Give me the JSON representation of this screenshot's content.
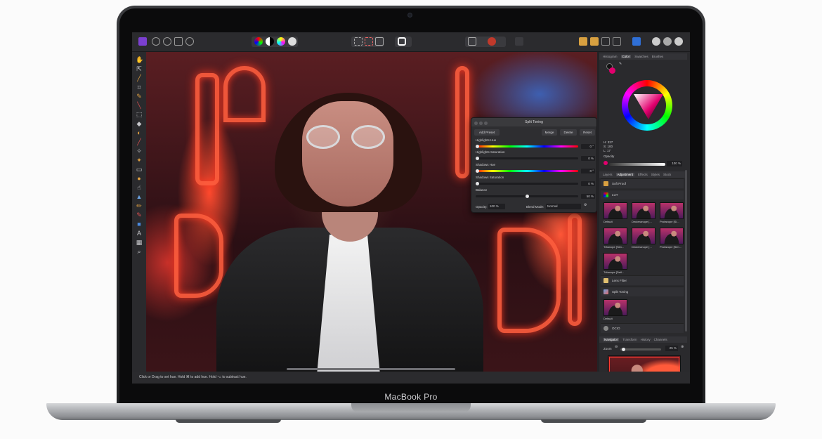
{
  "device": {
    "brand_label": "MacBook Pro"
  },
  "app": {
    "status_text": "Click or Drag to set hue. Hold ⌘ to add hue. Hold ⌥ to subtract hue.",
    "left_tools": [
      "hand-icon",
      "move-icon",
      "brush-icon",
      "crop-icon",
      "pen-icon",
      "eyedropper-icon",
      "marquee-icon",
      "fill-icon",
      "gradient-icon",
      "paint-icon",
      "retouch-icon",
      "clone-icon",
      "eraser-icon",
      "dodge-icon",
      "smudge-icon",
      "sharpen-icon",
      "shape-icon",
      "text-icon",
      "frame-icon",
      "zoom-icon"
    ]
  },
  "split_toning": {
    "title": "Split Toning",
    "add_preset": "Add Preset",
    "merge": "Merge",
    "delete": "Delete",
    "reset": "Reset",
    "highlights_hue_label": "Highlights Hue",
    "highlights_hue_value": "0 °",
    "highlights_sat_label": "Highlights Saturation",
    "highlights_sat_value": "0 %",
    "shadows_hue_label": "Shadows Hue",
    "shadows_hue_value": "0 °",
    "shadows_sat_label": "Shadows Saturation",
    "shadows_sat_value": "0 %",
    "balance_label": "Balance",
    "balance_value": "50 %",
    "opacity_label": "Opacity:",
    "opacity_value": "100 %",
    "blend_label": "Blend Mode:",
    "blend_value": "Normal"
  },
  "color_panel": {
    "tabs": [
      "Histogram",
      "Color",
      "Swatches",
      "Brushes"
    ],
    "active_tab": "Color",
    "h": "H: 337",
    "s": "S: 100",
    "l": "L: 17",
    "opacity_label": "Opacity",
    "opacity_value": "100 %",
    "primary_color": "#e2006e"
  },
  "adjustment_panel": {
    "tabs": [
      "Layers",
      "Adjustment",
      "Effects",
      "Styles",
      "Stock"
    ],
    "active_tab": "Adjustment",
    "items": {
      "soft_proof": "Soft Proof",
      "lut": "LUT",
      "lens_filter": "Lens Filter",
      "split_toning": "Split Toning",
      "ocio": "OCIO"
    },
    "lut_presets": [
      "Default",
      "Deuteranope [...",
      "Protanope [Si...",
      "Tritanope [Sim...",
      "Deuteranope [...",
      "Protanope [Sim...",
      "Tritanope [Defi..."
    ],
    "split_presets": [
      "Default"
    ]
  },
  "navigator_panel": {
    "tabs": [
      "Navigator",
      "Transform",
      "History",
      "Channels"
    ],
    "active_tab": "Navigator",
    "zoom_label": "Zoom",
    "zoom_value": "25 %"
  }
}
